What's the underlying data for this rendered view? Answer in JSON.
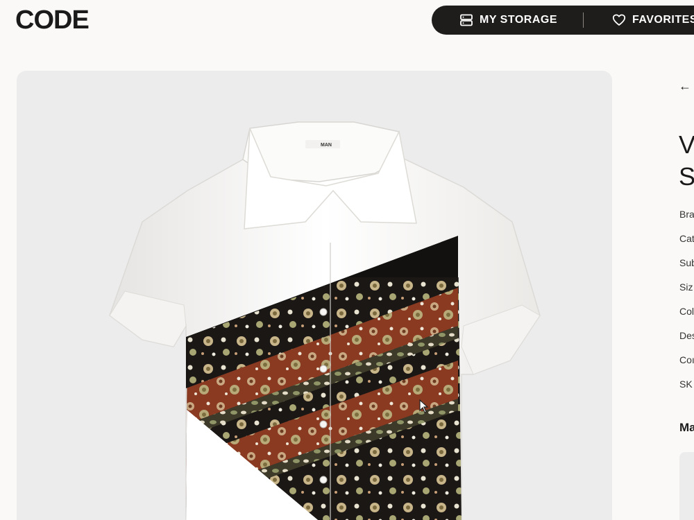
{
  "header": {
    "logo": "CODE",
    "nav": {
      "storage_label": "MY STORAGE",
      "favorites_label": "FAVORITES"
    }
  },
  "product": {
    "image_alt": "Printed short sleeve shirt",
    "collar_tag": "MAN",
    "back_label": "←",
    "title_lines": [
      "V",
      "S"
    ],
    "specs": [
      "Bra",
      "Cat",
      "Sub",
      "Siz",
      "Col",
      "Des",
      "Coı",
      "SK"
    ],
    "section_heading": "Ma"
  },
  "colors": {
    "page_bg": "#faf9f7",
    "nav_bg": "#1f1d1b",
    "panel_bg": "#ececed",
    "accent_rust": "#8b3a22",
    "accent_black": "#121110"
  }
}
